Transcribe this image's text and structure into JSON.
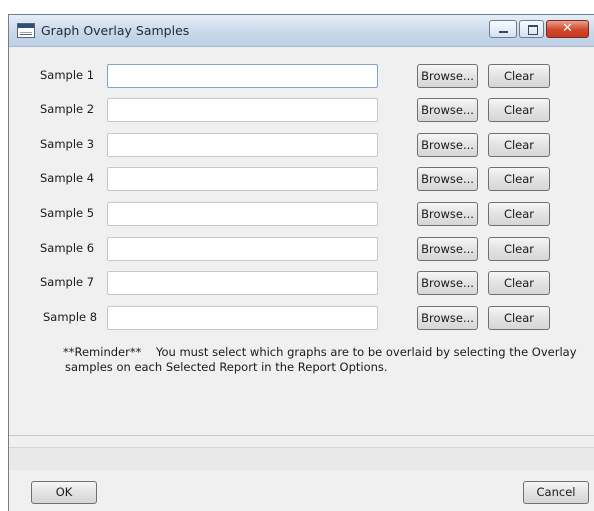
{
  "window": {
    "title": "Graph Overlay Samples",
    "controls": [
      "minimize-icon",
      "maximize-icon",
      "close-icon"
    ],
    "close_glyph": "✕"
  },
  "samples": [
    {
      "label": "Sample 1",
      "value": "",
      "browse_label": "Browse...",
      "clear_label": "Clear"
    },
    {
      "label": "Sample 2",
      "value": "",
      "browse_label": "Browse...",
      "clear_label": "Clear"
    },
    {
      "label": "Sample 3",
      "value": "",
      "browse_label": "Browse...",
      "clear_label": "Clear"
    },
    {
      "label": "Sample 4",
      "value": "",
      "browse_label": "Browse...",
      "clear_label": "Clear"
    },
    {
      "label": "Sample 5",
      "value": "",
      "browse_label": "Browse...",
      "clear_label": "Clear"
    },
    {
      "label": "Sample 6",
      "value": "",
      "browse_label": "Browse...",
      "clear_label": "Clear"
    },
    {
      "label": "Sample 7",
      "value": "",
      "browse_label": "Browse...",
      "clear_label": "Clear"
    },
    {
      "label": "Sample 8",
      "value": "",
      "browse_label": "Browse...",
      "clear_label": "Clear"
    }
  ],
  "reminder": {
    "line1": "**Reminder**    You must select which graphs are to be overlaid by selecting the Overlay",
    "line2": "samples on each Selected Report in the Report Options."
  },
  "footer": {
    "ok_label": "OK",
    "cancel_label": "Cancel"
  },
  "colors": {
    "window_bg": "#f0f0f0",
    "titlebar": "#c9d8ea",
    "close_button": "#d2462c"
  }
}
